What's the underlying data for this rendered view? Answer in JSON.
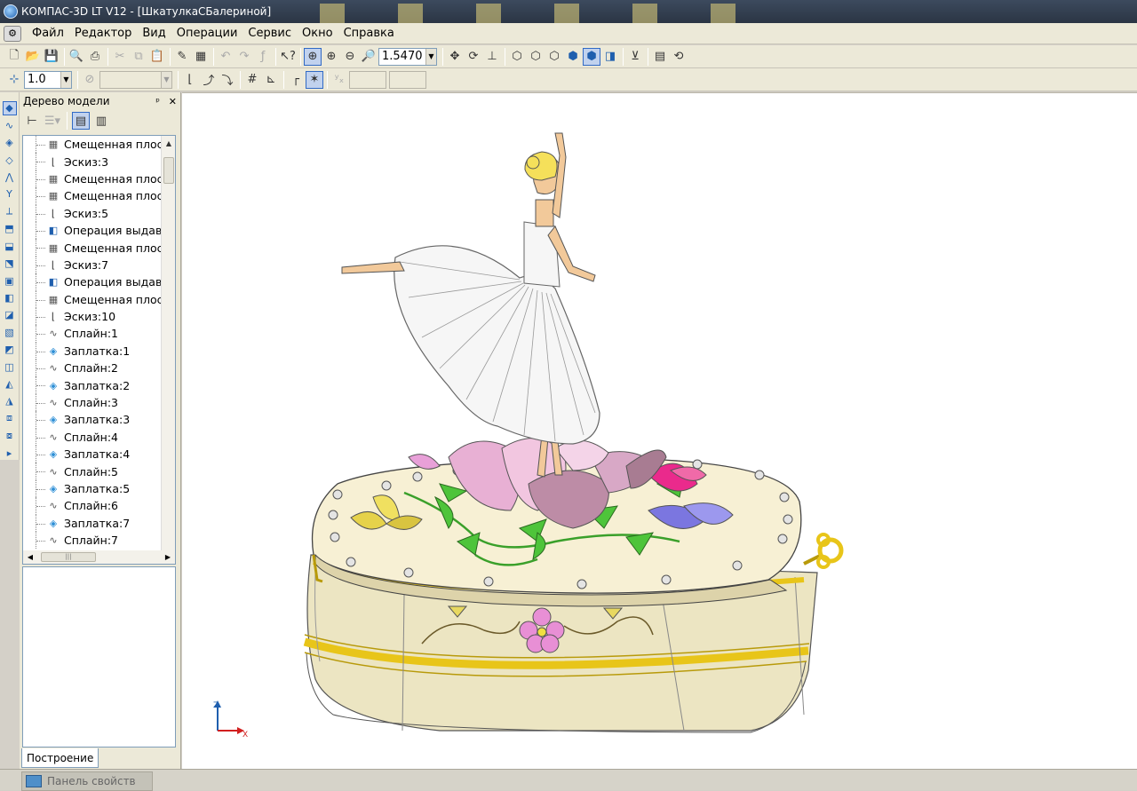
{
  "window": {
    "title": "КОМПАС-3D LT V12 - [ШкатулкаСБалериной]"
  },
  "menu": {
    "items": [
      "Файл",
      "Редактор",
      "Вид",
      "Операции",
      "Сервис",
      "Окно",
      "Справка"
    ]
  },
  "toolbar": {
    "zoom_value": "1.5470",
    "step_value": "1.0"
  },
  "panel": {
    "title": "Дерево модели",
    "pin_label": "ᵖ",
    "close_label": "✕",
    "bottom_tab": "Построение"
  },
  "tree": {
    "items": [
      {
        "label": "Смещенная плос",
        "icon": "plane-icon"
      },
      {
        "label": "Эскиз:3",
        "icon": "sketch-icon"
      },
      {
        "label": "Смещенная плос",
        "icon": "plane-icon"
      },
      {
        "label": "Смещенная плос",
        "icon": "plane-icon"
      },
      {
        "label": "Эскиз:5",
        "icon": "sketch-icon"
      },
      {
        "label": "Операция выдав",
        "icon": "extrude-icon"
      },
      {
        "label": "Смещенная плос",
        "icon": "plane-icon"
      },
      {
        "label": "Эскиз:7",
        "icon": "sketch-icon"
      },
      {
        "label": "Операция выдав",
        "icon": "extrude-icon"
      },
      {
        "label": "Смещенная плос",
        "icon": "plane-icon"
      },
      {
        "label": "Эскиз:10",
        "icon": "sketch-icon"
      },
      {
        "label": "Сплайн:1",
        "icon": "spline-icon"
      },
      {
        "label": "Заплатка:1",
        "icon": "patch-icon"
      },
      {
        "label": "Сплайн:2",
        "icon": "spline-icon"
      },
      {
        "label": "Заплатка:2",
        "icon": "patch-icon"
      },
      {
        "label": "Сплайн:3",
        "icon": "spline-icon"
      },
      {
        "label": "Заплатка:3",
        "icon": "patch-icon"
      },
      {
        "label": "Сплайн:4",
        "icon": "spline-icon"
      },
      {
        "label": "Заплатка:4",
        "icon": "patch-icon"
      },
      {
        "label": "Сплайн:5",
        "icon": "spline-icon"
      },
      {
        "label": "Заплатка:5",
        "icon": "patch-icon"
      },
      {
        "label": "Сплайн:6",
        "icon": "spline-icon"
      },
      {
        "label": "Заплатка:7",
        "icon": "patch-icon"
      },
      {
        "label": "Сплайн:7",
        "icon": "spline-icon"
      }
    ]
  },
  "viewport": {
    "axis_z": "Z",
    "axis_x": "X"
  },
  "statusbar": {
    "tab_label": "Панель свойств"
  },
  "colors": {
    "box_body": "#f5edc8",
    "gold_trim": "#e8c519",
    "lid": "#f7f0d4",
    "leaf": "#4ec43a",
    "skin": "#f2c99a"
  }
}
